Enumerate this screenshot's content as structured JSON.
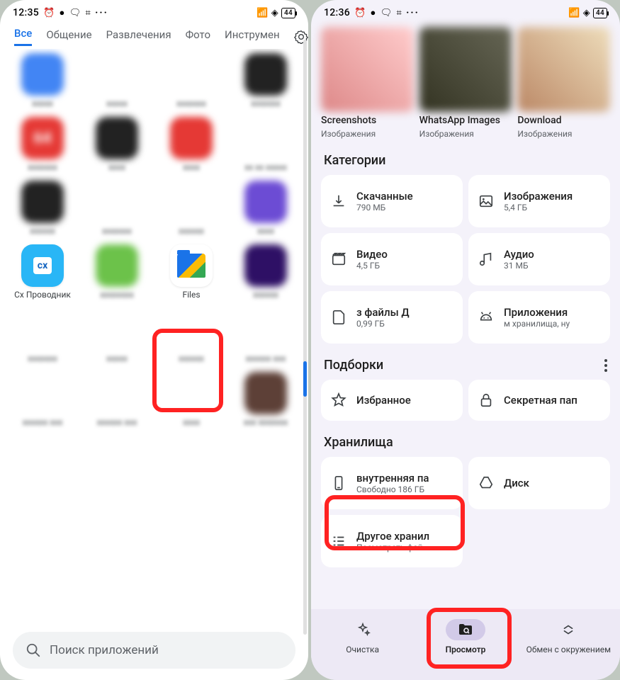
{
  "left": {
    "status": {
      "time": "12:35",
      "battery": "44"
    },
    "tabs": [
      "Все",
      "Общение",
      "Развлечения",
      "Фото",
      "Инструмен"
    ],
    "apps": {
      "cx_label": "Cx Проводник",
      "files_label": "Files"
    },
    "search_placeholder": "Поиск приложений"
  },
  "right": {
    "status": {
      "time": "12:36",
      "battery": "44"
    },
    "folders": [
      {
        "title": "Screenshots",
        "sub": "Изображения"
      },
      {
        "title": "WhatsApp Images",
        "sub": "Изображения"
      },
      {
        "title": "Download",
        "sub": "Изображения"
      }
    ],
    "categories_title": "Категории",
    "categories": [
      {
        "title": "Скачанные",
        "sub": "790 МБ"
      },
      {
        "title": "Изображения",
        "sub": "5,4 ГБ"
      },
      {
        "title": "Видео",
        "sub": "4,5 ГБ"
      },
      {
        "title": "Аудио",
        "sub": "31 МБ"
      },
      {
        "title": "з файлы        Д",
        "sub": "0,99 ГБ"
      },
      {
        "title": "Приложения",
        "sub": "м хранилища, ну"
      }
    ],
    "collections_title": "Подборки",
    "collections": [
      {
        "title": "Избранное"
      },
      {
        "title": "Секретная пап"
      }
    ],
    "storage_title": "Хранилища",
    "storage": [
      {
        "title": "внутренняя па",
        "sub": "Свободно 186 ГБ"
      },
      {
        "title": "Диск",
        "sub": ""
      },
      {
        "title": "Другое хранил",
        "sub": "Посмотреть фай"
      }
    ],
    "nav": [
      "Очистка",
      "Просмотр",
      "Обмен с окружением"
    ]
  }
}
